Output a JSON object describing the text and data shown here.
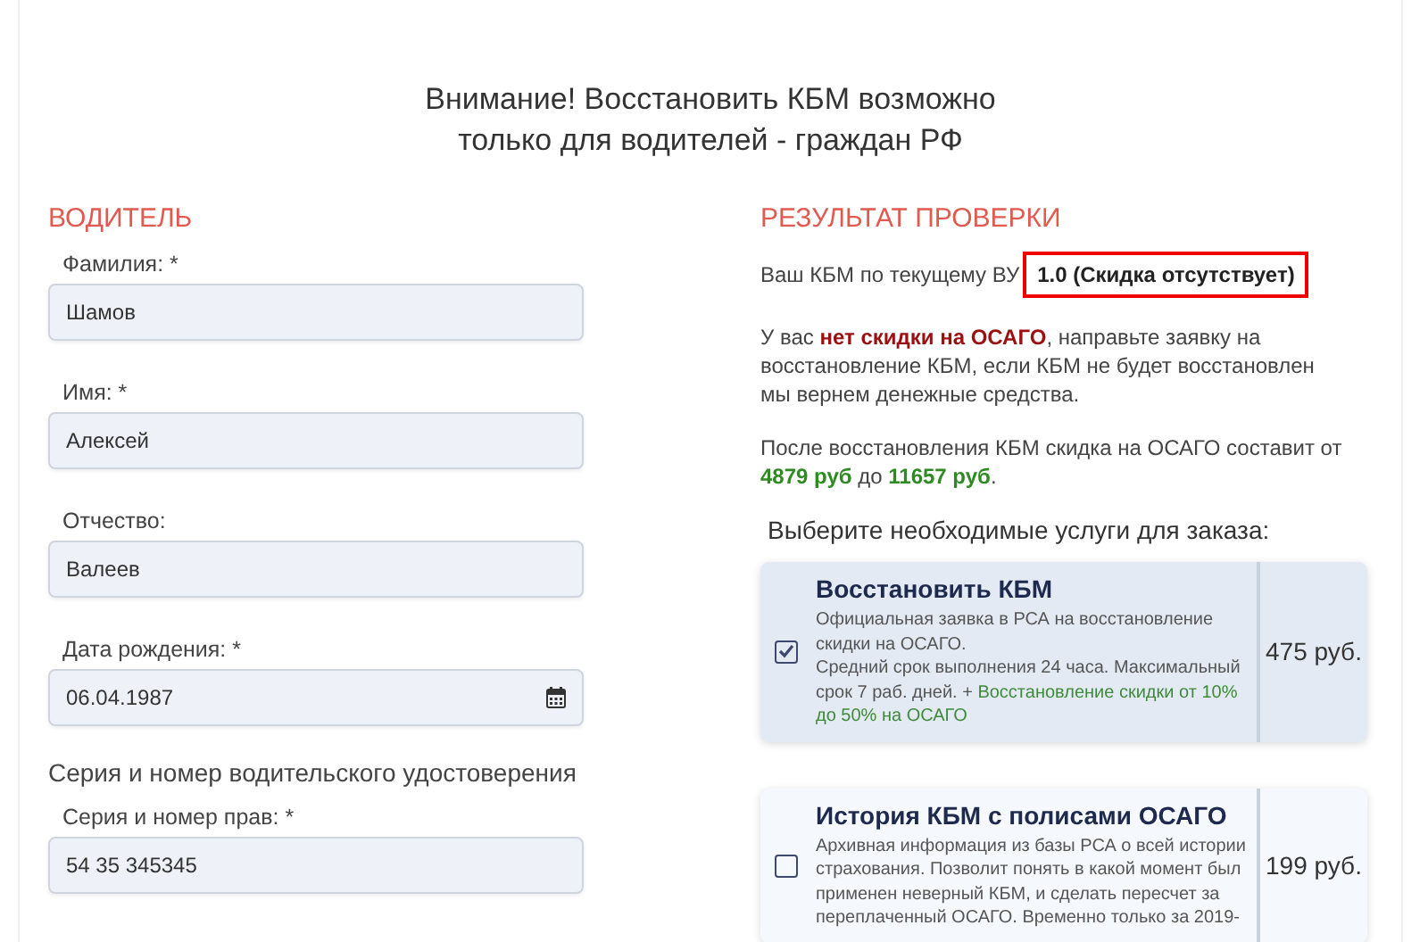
{
  "notice": [
    "Внимание! Восстановить КБМ возможно",
    "только для водителей - граждан РФ"
  ],
  "driver": {
    "title": "ВОДИТЕЛЬ",
    "fields": [
      {
        "label": "Фамилия: *",
        "value": "Шамов",
        "kind": "text"
      },
      {
        "label": "Имя: *",
        "value": "Алексей",
        "kind": "text"
      },
      {
        "label": "Отчество:",
        "value": "Валеев",
        "kind": "text"
      },
      {
        "label": "Дата рождения: *",
        "value": "06.04.1987",
        "kind": "date"
      }
    ],
    "license_title": "Серия и номер водительского удостоверения",
    "license_field": {
      "label": "Серия и номер прав: *",
      "value": "54 35 345345",
      "kind": "text"
    }
  },
  "result": {
    "title": "РЕЗУЛЬТАТ ПРОВЕРКИ",
    "kbm_label": "Ваш КБМ по текущему ВУ",
    "kbm_value": "1.0 (Скидка отсутствует)",
    "warning": "У вас **нет скидки на ОСАГО**, направьте заявку на восстановление КБМ, если КБМ не будет восстановлен мы вернем денежные средства.",
    "saving": "После восстановления КБМ скидка на ОСАГО составит от **4879 руб** до **11657 руб**.",
    "services_title": "Выберите необходимые услуги для заказа:",
    "services": [
      {
        "title": "Восстановить КБМ",
        "description": "Официальная заявка в РСА на восстановление скидки на ОСАГО.\nСредний срок выполнения 24 часа. Максимальный срок 7 раб. дней. + ",
        "note": "Восстановление скидки от 10% до 50% на ОСАГО",
        "price": "475 руб.",
        "checked": true
      },
      {
        "title": "История КБМ с полисами ОСАГО",
        "description": "Архивная информация из базы РСА о всей истории страхования. Позволит понять в какой момент был применен неверный КБМ, и сделать пересчет за переплаченный ОСАГО. Временно только за 2019-",
        "price": "199 руб.",
        "checked": false
      }
    ]
  }
}
